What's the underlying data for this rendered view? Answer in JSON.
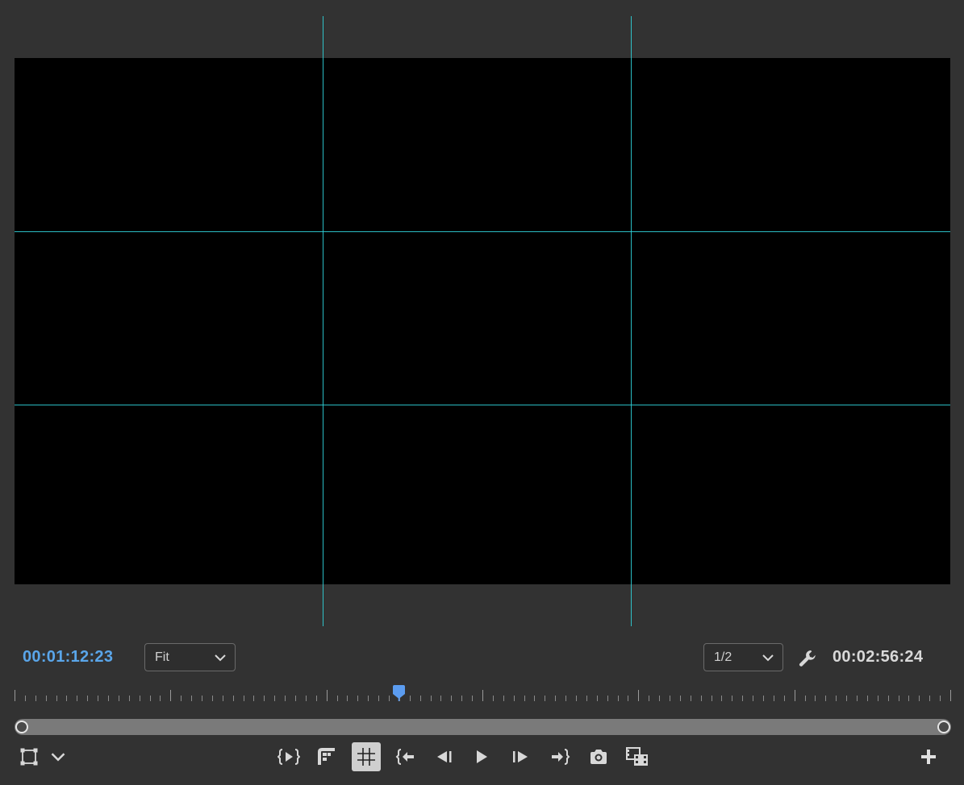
{
  "monitor": {
    "current_timecode": "00:01:12:23",
    "duration_timecode": "00:02:56:24",
    "zoom_level": "Fit",
    "playback_resolution": "1/2",
    "playhead_position_fraction": 0.41
  },
  "colors": {
    "accent": "#5aa6ea",
    "guide_lines": "#2fd0d8",
    "panel_bg": "#323232",
    "frame_bg": "#000000"
  },
  "icons": {
    "safe_margins": "safe-margins-icon",
    "settings": "wrench-icon",
    "toggle_proxies": "toggle-proxies-icon"
  },
  "transport": [
    {
      "name": "insert-button",
      "icon": "insert-icon"
    },
    {
      "name": "overwrite-button",
      "icon": "overwrite-icon"
    },
    {
      "name": "guides-button",
      "icon": "grid-icon",
      "active": true
    },
    {
      "name": "go-to-in-button",
      "icon": "go-to-in-icon"
    },
    {
      "name": "step-back-button",
      "icon": "step-back-icon"
    },
    {
      "name": "play-button",
      "icon": "play-icon"
    },
    {
      "name": "step-forward-button",
      "icon": "step-forward-icon"
    },
    {
      "name": "go-to-out-button",
      "icon": "go-to-out-icon"
    },
    {
      "name": "export-frame-button",
      "icon": "camera-icon"
    },
    {
      "name": "compare-view-button",
      "icon": "compare-icon"
    }
  ]
}
